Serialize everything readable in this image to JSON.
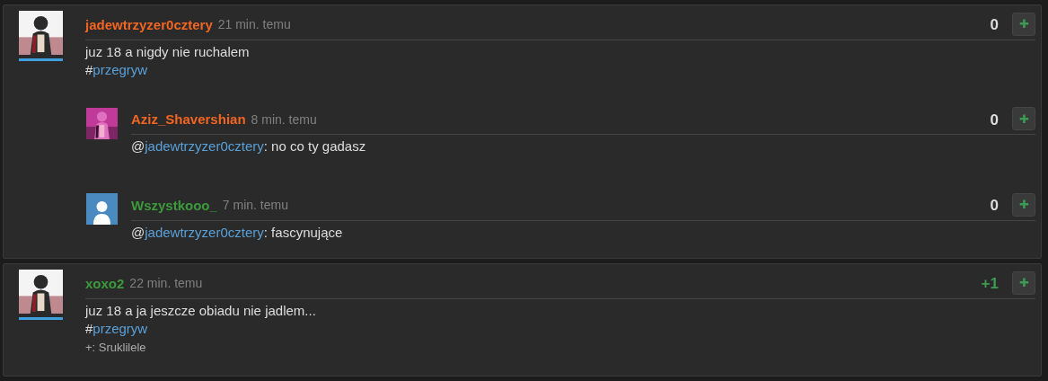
{
  "posts": [
    {
      "author": {
        "name": "jadewtrzyzer0cztery",
        "color": "#f26522"
      },
      "time": "21 min. temu",
      "avatar": {
        "kind": "picture",
        "underline": true
      },
      "score": {
        "text": "0",
        "kind": "neutral"
      },
      "plus_button": "✚",
      "lines": [
        [
          {
            "text": "juz 18 a nigdy nie ruchalem",
            "link": false
          }
        ],
        [
          {
            "text": "#",
            "link": false
          },
          {
            "text": "przegryw",
            "link": true
          }
        ]
      ],
      "replies": [
        {
          "author": {
            "name": "Aziz_Shavershian",
            "color": "#f26522"
          },
          "time": "8 min. temu",
          "avatar": {
            "kind": "picture",
            "underline": false
          },
          "score": {
            "text": "0",
            "kind": "neutral"
          },
          "plus_button": "✚",
          "lines": [
            [
              {
                "text": "@",
                "link": false
              },
              {
                "text": "jadewtrzyzer0cztery",
                "link": true
              },
              {
                "text": ": no co ty gadasz",
                "link": false
              }
            ]
          ]
        },
        {
          "author": {
            "name": "Wszystkooo_",
            "color": "#3c9a3c"
          },
          "time": "7 min. temu",
          "avatar": {
            "kind": "default",
            "underline": false
          },
          "score": {
            "text": "0",
            "kind": "neutral"
          },
          "plus_button": "✚",
          "lines": [
            [
              {
                "text": "@",
                "link": false
              },
              {
                "text": "jadewtrzyzer0cztery",
                "link": true
              },
              {
                "text": ": fascynujące",
                "link": false
              }
            ]
          ]
        }
      ]
    },
    {
      "author": {
        "name": "xoxo2",
        "color": "#3c9a3c"
      },
      "time": "22 min. temu",
      "avatar": {
        "kind": "picture",
        "underline": true
      },
      "score": {
        "text": "+1",
        "kind": "positive"
      },
      "plus_button": "✚",
      "lines": [
        [
          {
            "text": "juz 18 a ja jeszcze obiadu nie jadlem...",
            "link": false
          }
        ],
        [
          {
            "text": "#",
            "link": false
          },
          {
            "text": "przegryw",
            "link": true
          }
        ]
      ],
      "voters": "+: Sruklilele"
    }
  ]
}
